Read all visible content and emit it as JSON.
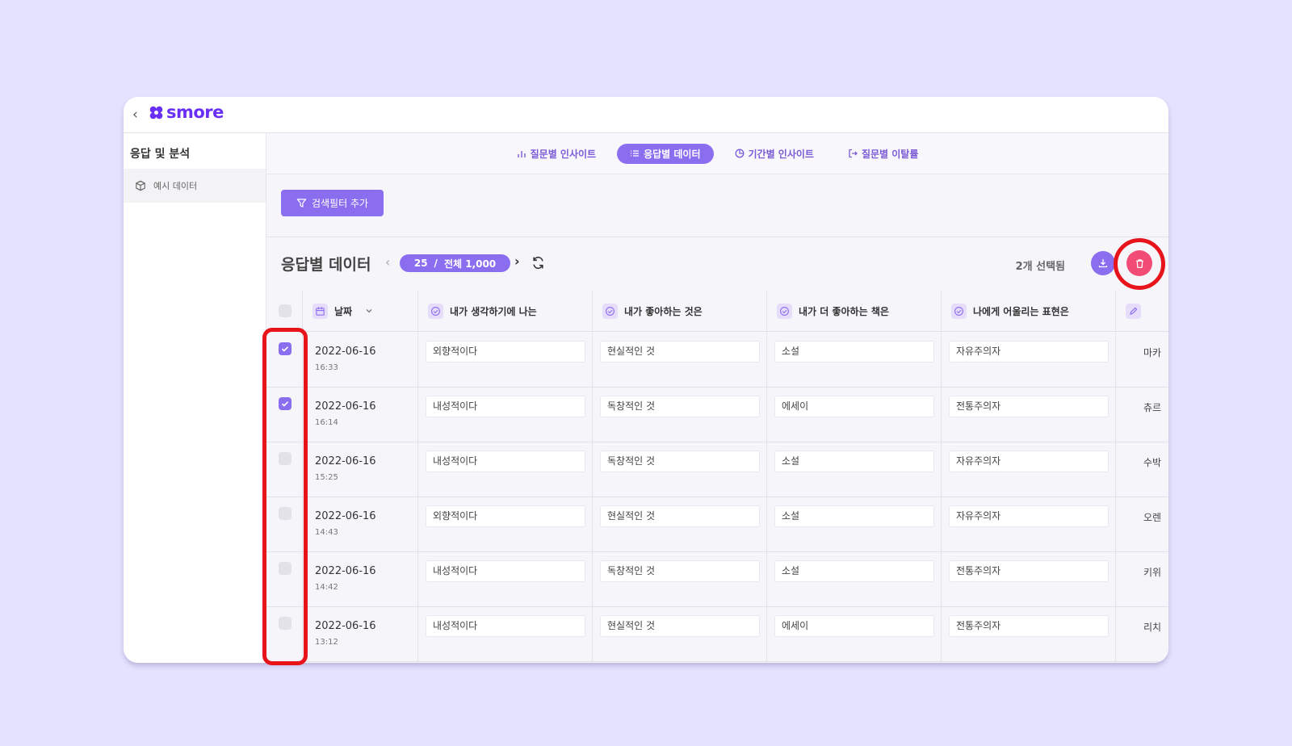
{
  "app": {
    "logo_text": "smore",
    "back_label": "‹"
  },
  "sidebar": {
    "title": "응답 및 분석",
    "items": [
      {
        "label": "예시 데이터",
        "icon": "cube-icon"
      }
    ]
  },
  "tabs": [
    {
      "label": "질문별 인사이트",
      "icon": "bar-chart-icon",
      "active": false
    },
    {
      "label": "응답별 데이터",
      "icon": "list-icon",
      "active": true
    },
    {
      "label": "기간별 인사이트",
      "icon": "pie-chart-icon",
      "active": false
    },
    {
      "label": "질문별 이탈률",
      "icon": "exit-icon",
      "active": false
    }
  ],
  "filter": {
    "label": "검색필터 추가"
  },
  "section": {
    "title": "응답별 데이터",
    "pager_current": "25",
    "pager_sep": "/",
    "pager_total": "전체 1,000",
    "selected_count": "2개 선택됨"
  },
  "columns": [
    {
      "label": "날짜"
    },
    {
      "label": "내가 생각하기에 나는"
    },
    {
      "label": "내가 좋아하는 것은"
    },
    {
      "label": "내가 더 좋아하는 책은"
    },
    {
      "label": "나에게 어울리는 표현은"
    }
  ],
  "rows": [
    {
      "checked": true,
      "date": "2022-06-16",
      "time": "16:33",
      "c1": "외향적이다",
      "c2": "현실적인 것",
      "c3": "소설",
      "c4": "자유주의자",
      "c5": "마카"
    },
    {
      "checked": true,
      "date": "2022-06-16",
      "time": "16:14",
      "c1": "내성적이다",
      "c2": "독창적인 것",
      "c3": "에세이",
      "c4": "전통주의자",
      "c5": "츄르"
    },
    {
      "checked": false,
      "date": "2022-06-16",
      "time": "15:25",
      "c1": "내성적이다",
      "c2": "독창적인 것",
      "c3": "소설",
      "c4": "자유주의자",
      "c5": "수박"
    },
    {
      "checked": false,
      "date": "2022-06-16",
      "time": "14:43",
      "c1": "외향적이다",
      "c2": "현실적인 것",
      "c3": "소설",
      "c4": "자유주의자",
      "c5": "오렌"
    },
    {
      "checked": false,
      "date": "2022-06-16",
      "time": "14:42",
      "c1": "내성적이다",
      "c2": "독창적인 것",
      "c3": "소설",
      "c4": "전통주의자",
      "c5": "키위"
    },
    {
      "checked": false,
      "date": "2022-06-16",
      "time": "13:12",
      "c1": "내성적이다",
      "c2": "현실적인 것",
      "c3": "에세이",
      "c4": "전통주의자",
      "c5": "리치"
    }
  ],
  "colors": {
    "accent": "#8b6ef0",
    "danger": "#f24b76",
    "highlight": "#e8141c",
    "brand": "#6a2ff5"
  }
}
